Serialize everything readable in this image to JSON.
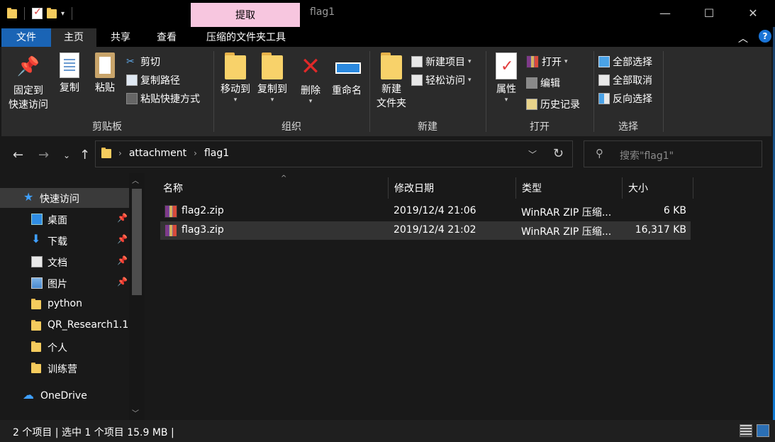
{
  "window": {
    "title": "flag1",
    "context_tab": "提取"
  },
  "ribbon_tabs": [
    "文件",
    "主页",
    "共享",
    "查看",
    "压缩的文件夹工具"
  ],
  "clipboard": {
    "pin_line1": "固定到",
    "pin_line2": "快速访问",
    "copy": "复制",
    "paste": "粘贴",
    "cut": "剪切",
    "copy_path": "复制路径",
    "paste_shortcut": "粘贴快捷方式",
    "group_label": "剪贴板"
  },
  "organize": {
    "move_to": "移动到",
    "copy_to": "复制到",
    "delete": "删除",
    "rename": "重命名",
    "group_label": "组织"
  },
  "new": {
    "new_folder_line1": "新建",
    "new_folder_line2": "文件夹",
    "new_item": "新建项目",
    "easy_access": "轻松访问",
    "group_label": "新建"
  },
  "open": {
    "properties": "属性",
    "open": "打开",
    "edit": "编辑",
    "history": "历史记录",
    "group_label": "打开"
  },
  "select": {
    "select_all": "全部选择",
    "select_none": "全部取消",
    "invert": "反向选择",
    "group_label": "选择"
  },
  "address": {
    "crumbs": [
      "attachment",
      "flag1"
    ],
    "search_placeholder": "搜索\"flag1\""
  },
  "nav_pane": {
    "items": [
      {
        "label": "快速访问",
        "icon": "star-icon"
      },
      {
        "label": "桌面",
        "icon": "desktop-icon",
        "pinned": true
      },
      {
        "label": "下载",
        "icon": "download-icon",
        "pinned": true
      },
      {
        "label": "文档",
        "icon": "document-icon",
        "pinned": true
      },
      {
        "label": "图片",
        "icon": "picture-icon",
        "pinned": true
      },
      {
        "label": "python",
        "icon": "folder-icon"
      },
      {
        "label": "QR_Research1.1",
        "icon": "folder-icon"
      },
      {
        "label": "个人",
        "icon": "folder-icon"
      },
      {
        "label": "训练营",
        "icon": "folder-icon"
      },
      {
        "label": "OneDrive",
        "icon": "cloud-icon"
      }
    ]
  },
  "columns": [
    "名称",
    "修改日期",
    "类型",
    "大小"
  ],
  "files": [
    {
      "name": "flag2.zip",
      "date": "2019/12/4 21:06",
      "type": "WinRAR ZIP 压缩...",
      "size": "6 KB"
    },
    {
      "name": "flag3.zip",
      "date": "2019/12/4 21:02",
      "type": "WinRAR ZIP 压缩...",
      "size": "16,317 KB"
    }
  ],
  "status": {
    "text": "2 个项目  |  选中 1 个项目  15.9 MB  |"
  }
}
